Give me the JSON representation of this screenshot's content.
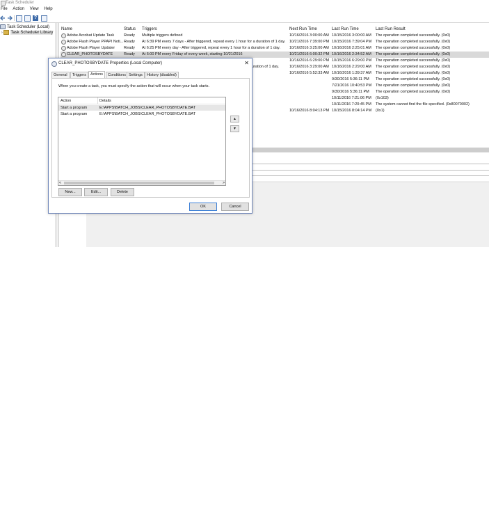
{
  "window": {
    "title": "Task Scheduler"
  },
  "menu": [
    "File",
    "Action",
    "View",
    "Help"
  ],
  "toolbar": {
    "back_icon": "arrow-left-icon",
    "forward_icon": "arrow-right-icon",
    "help_glyph": "?"
  },
  "tree": {
    "root": "Task Scheduler (Local)",
    "library": "Task Scheduler Library"
  },
  "task_list": {
    "columns": [
      "Name",
      "Status",
      "Triggers",
      "Next Run Time",
      "Last Run Time",
      "Last Run Result"
    ],
    "rows": [
      {
        "name": "Adobe Acrobat Update Task",
        "status": "Ready",
        "triggers": "Multiple triggers defined",
        "next": "10/16/2016 3:00:00 AM",
        "last": "10/15/2016 3:00:00 AM",
        "result": "The operation completed successfully. (0x0)"
      },
      {
        "name": "Adobe Flash Player PPAPI Noti...",
        "status": "Ready",
        "triggers": "At 6:39 PM every 7 days - After triggered, repeat every 1 hour for a duration of 1 day.",
        "next": "10/21/2016 7:39:00 PM",
        "last": "10/15/2016 7:39:04 PM",
        "result": "The operation completed successfully. (0x0)"
      },
      {
        "name": "Adobe Flash Player Updater",
        "status": "Ready",
        "triggers": "At 6:25 PM every day - After triggered, repeat every 1 hour for a duration of 1 day.",
        "next": "10/16/2016 3:25:00 AM",
        "last": "10/16/2016 2:25:01 AM",
        "result": "The operation completed successfully. (0x0)"
      },
      {
        "name": "CLEAR_PHOTOSBYDATE",
        "status": "Ready",
        "triggers": "At 6:00 PM every Friday of every week, starting 10/21/2016",
        "next": "10/21/2016 6:00:32 PM",
        "last": "10/16/2016 2:34:52 AM",
        "result": "The operation completed successfully. (0x0)"
      },
      {
        "name": "",
        "status": "",
        "triggers": "",
        "next": "10/16/2016 6:29:00 PM",
        "last": "10/15/2016 6:29:00 PM",
        "result": "The operation completed successfully. (0x0)"
      },
      {
        "name": "",
        "status": "",
        "triggers": "uration of 1 day.",
        "next": "10/16/2016 3:29:00 AM",
        "last": "10/16/2016 2:29:00 AM",
        "result": "The operation completed successfully. (0x0)"
      },
      {
        "name": "",
        "status": "",
        "triggers": "",
        "next": "10/16/2016 5:52:33 AM",
        "last": "10/16/2016 1:39:37 AM",
        "result": "The operation completed successfully. (0x0)"
      },
      {
        "name": "",
        "status": "",
        "triggers": "",
        "next": "",
        "last": "9/30/2016 5:36:11 PM",
        "result": "The operation completed successfully. (0x0)"
      },
      {
        "name": "",
        "status": "",
        "triggers": "",
        "next": "",
        "last": "7/21/2016 10:40:53 PM",
        "result": "The operation completed successfully. (0x0)"
      },
      {
        "name": "",
        "status": "",
        "triggers": "",
        "next": "",
        "last": "9/30/2016 5:36:11 PM",
        "result": "The operation completed successfully. (0x0)"
      },
      {
        "name": "",
        "status": "",
        "triggers": "",
        "next": "",
        "last": "10/11/2016 7:21:06 PM",
        "result": "(0x103)"
      },
      {
        "name": "",
        "status": "",
        "triggers": "",
        "next": "",
        "last": "10/11/2016 7:20:45 PM",
        "result": "The system cannot find the file specified. (0x80070002)"
      },
      {
        "name": "",
        "status": "",
        "triggers": "",
        "next": "10/16/2016 8:04:13 PM",
        "last": "10/15/2016 8:04:14 PM",
        "result": "(0x1)"
      }
    ]
  },
  "dialog": {
    "title": "CLEAR_PHOTOSBYDATE Properties (Local Computer)",
    "close_glyph": "✕",
    "tabs": [
      "General",
      "Triggers",
      "Actions",
      "Conditions",
      "Settings",
      "History (disabled)"
    ],
    "active_tab": "Actions",
    "description": "When you create a task, you must specify the action that will occur when your task starts.",
    "table": {
      "columns": [
        "Action",
        "Details"
      ],
      "rows": [
        {
          "action": "Start a program",
          "details": "E:\\APPS\\BATCH_JOBS\\CLEAR_PHOTOSBYDATE.BAT"
        },
        {
          "action": "Start a program",
          "details": "E:\\APPS\\BATCH_JOBS\\CLEAR_PHOTOSBYDATE.BAT"
        }
      ]
    },
    "move_up_glyph": "▲",
    "move_down_glyph": "▼",
    "scroll_left_glyph": "<",
    "scroll_right_glyph": ">",
    "buttons": {
      "new": "New...",
      "edit": "Edit...",
      "delete": "Delete",
      "ok": "OK",
      "cancel": "Cancel"
    }
  }
}
